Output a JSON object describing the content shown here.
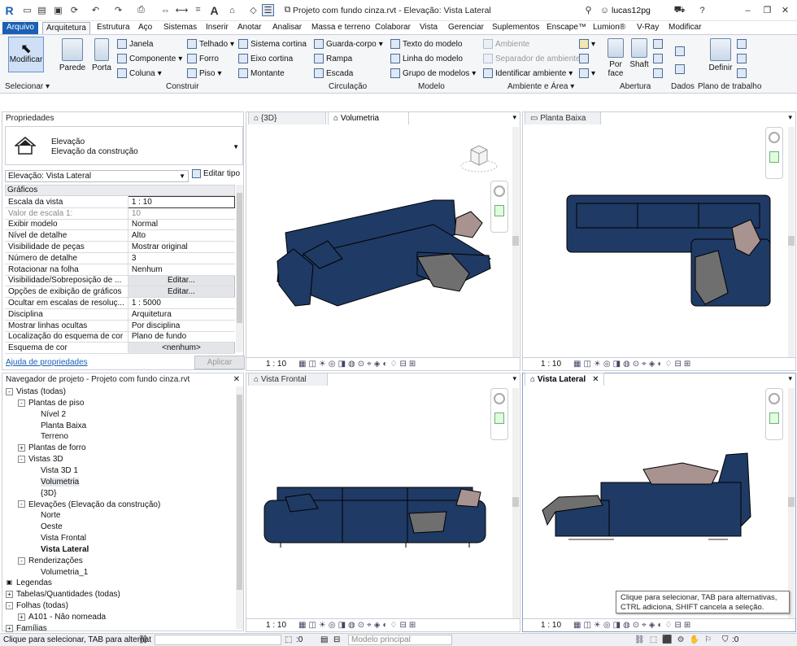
{
  "window_title": "Projeto com fundo cinza.rvt - Elevação: Vista Lateral",
  "user": "lucas12pg",
  "tabs": [
    "Arquivo",
    "Arquitetura",
    "Estrutura",
    "Aço",
    "Sistemas",
    "Inserir",
    "Anotar",
    "Analisar",
    "Massa e terreno",
    "Colaborar",
    "Vista",
    "Gerenciar",
    "Suplementos",
    "Enscape™",
    "Lumion®",
    "V-Ray",
    "Modificar"
  ],
  "ribbon": {
    "modificar": "Modificar",
    "parede": "Parede",
    "porta": "Porta",
    "janela": "Janela",
    "componente": "Componente",
    "coluna": "Coluna",
    "telhado": "Telhado",
    "forro": "Forro",
    "piso": "Piso",
    "sistema_cortina": "Sistema cortina",
    "eixo_cortina": "Eixo cortina",
    "montante": "Montante",
    "guarda_corpo": "Guarda-corpo",
    "rampa": "Rampa",
    "escada": "Escada",
    "texto_modelo": "Texto do modelo",
    "linha_modelo": "Linha do modelo",
    "grupo_modelos": "Grupo de modelos",
    "ambiente": "Ambiente",
    "separador_ambiente": "Separador de ambiente",
    "identificar_ambiente": "Identificar ambiente",
    "por_face": "Por face",
    "shaft": "Shaft",
    "definir": "Definir",
    "groups": {
      "selecionar": "Selecionar",
      "construir": "Construir",
      "circulacao": "Circulação",
      "modelo": "Modelo",
      "ambiente_area": "Ambiente e Área",
      "abertura": "Abertura",
      "dados": "Dados",
      "plano": "Plano de trabalho"
    }
  },
  "properties": {
    "title": "Propriedades",
    "type_line1": "Elevação",
    "type_line2": "Elevação da construção",
    "selector": "Elevação: Vista Lateral",
    "edit_type": "Editar tipo",
    "section": "Gráficos",
    "rows": [
      {
        "k": "Escala da vista",
        "v": "1 : 10"
      },
      {
        "k": "Valor de escala    1:",
        "v": "10"
      },
      {
        "k": "Exibir modelo",
        "v": "Normal"
      },
      {
        "k": "Nível de detalhe",
        "v": "Alto"
      },
      {
        "k": "Visibilidade de peças",
        "v": "Mostrar original"
      },
      {
        "k": "Número de detalhe",
        "v": "3"
      },
      {
        "k": "Rotacionar na folha",
        "v": "Nenhum"
      },
      {
        "k": "Visibilidade/Sobreposição de ...",
        "v": "Editar..."
      },
      {
        "k": "Opções de exibição de gráficos",
        "v": "Editar..."
      },
      {
        "k": "Ocultar em escalas de resoluç...",
        "v": "1 : 5000"
      },
      {
        "k": "Disciplina",
        "v": "Arquitetura"
      },
      {
        "k": "Mostrar linhas ocultas",
        "v": "Por disciplina"
      },
      {
        "k": "Localização do esquema de cor",
        "v": "Plano de fundo"
      },
      {
        "k": "Esquema de cor",
        "v": "<nenhum>"
      }
    ],
    "help": "Ajuda de propriedades",
    "apply": "Aplicar"
  },
  "browser": {
    "title": "Navegador de projeto - Projeto com fundo cinza.rvt",
    "items": [
      {
        "label": "Vistas (todas)",
        "lvl": 0,
        "tog": "-"
      },
      {
        "label": "Plantas de piso",
        "lvl": 1,
        "tog": "-"
      },
      {
        "label": "Nível 2",
        "lvl": 2,
        "tog": ""
      },
      {
        "label": "Planta Baixa",
        "lvl": 2,
        "tog": ""
      },
      {
        "label": "Terreno",
        "lvl": 2,
        "tog": ""
      },
      {
        "label": "Plantas de forro",
        "lvl": 1,
        "tog": "+"
      },
      {
        "label": "Vistas 3D",
        "lvl": 1,
        "tog": "-"
      },
      {
        "label": "Vista 3D 1",
        "lvl": 2,
        "tog": ""
      },
      {
        "label": "Volumetria",
        "lvl": 2,
        "tog": ""
      },
      {
        "label": "{3D}",
        "lvl": 2,
        "tog": ""
      },
      {
        "label": "Elevações (Elevação da construção)",
        "lvl": 1,
        "tog": "-"
      },
      {
        "label": "Norte",
        "lvl": 2,
        "tog": ""
      },
      {
        "label": "Oeste",
        "lvl": 2,
        "tog": ""
      },
      {
        "label": "Vista Frontal",
        "lvl": 2,
        "tog": ""
      },
      {
        "label": "Vista Lateral",
        "lvl": 2,
        "tog": "",
        "bold": true
      },
      {
        "label": "Renderizações",
        "lvl": 1,
        "tog": "-"
      },
      {
        "label": "Volumetria_1",
        "lvl": 2,
        "tog": ""
      },
      {
        "label": "Legendas",
        "lvl": 0,
        "tog": ""
      },
      {
        "label": "Tabelas/Quantidades (todas)",
        "lvl": 0,
        "tog": "+"
      },
      {
        "label": "Folhas (todas)",
        "lvl": 0,
        "tog": "-"
      },
      {
        "label": "A101 - Não nomeada",
        "lvl": 1,
        "tog": "+"
      },
      {
        "label": "Famílias",
        "lvl": 0,
        "tog": "+"
      }
    ]
  },
  "views": {
    "tab_3d": "{3D}",
    "tab_volumetria": "Volumetria",
    "tab_planta": "Planta Baixa",
    "tab_frontal": "Vista Frontal",
    "tab_lateral": "Vista Lateral",
    "scale": "1 : 10"
  },
  "tooltip": "Clique para selecionar, TAB para alternativas, CTRL adiciona, SHIFT cancela a seleção.",
  "status": {
    "text": "Clique para selecionar, TAB para alternat",
    "zero": ":0",
    "model": "Modelo principal",
    "filter": ":0"
  },
  "colors": {
    "accent": "#1a5fb4",
    "sofa": "#1f3a64",
    "pillow": "#a89390",
    "throw": "#6f6f6f"
  }
}
